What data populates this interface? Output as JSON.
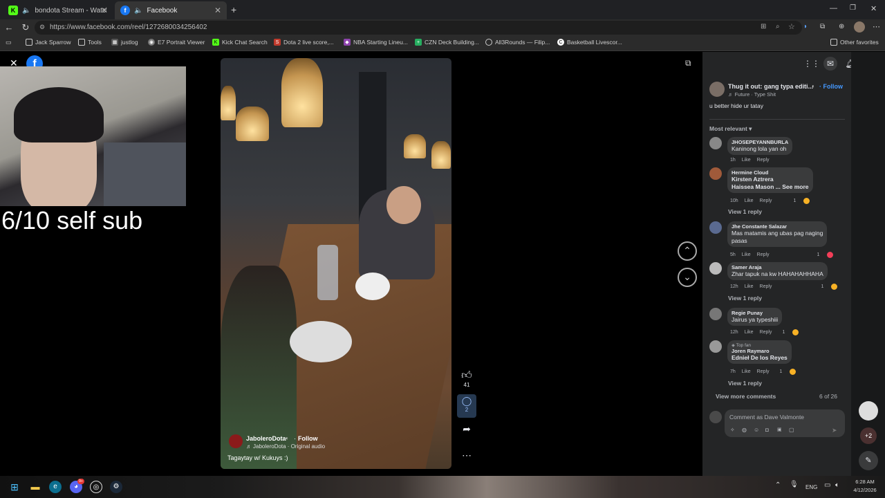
{
  "tabs": [
    {
      "title": "bondota Stream - Watch Live",
      "icon": "kick-icon",
      "active": false
    },
    {
      "title": "Facebook",
      "icon": "facebook-icon",
      "active": true
    }
  ],
  "address": {
    "url": "https://www.facebook.com/reel/1272680034256402"
  },
  "bookmarks": [
    {
      "label": "Jack Sparrow",
      "icon": "folder-icon"
    },
    {
      "label": "Tools",
      "icon": "folder-icon"
    },
    {
      "label": "justlog",
      "icon": "page-icon"
    },
    {
      "label": "E7 Portrait Viewer",
      "icon": "page-icon"
    },
    {
      "label": "Kick Chat Search",
      "icon": "kick-icon"
    },
    {
      "label": "Dota 2 live score,...",
      "icon": "page-icon"
    },
    {
      "label": "NBA Starting Lineu...",
      "icon": "page-icon"
    },
    {
      "label": "CZN Deck Building...",
      "icon": "page-icon"
    },
    {
      "label": "All3Rounds — Filip...",
      "icon": "globe-icon"
    },
    {
      "label": "Basketball Livescor...",
      "icon": "page-icon"
    },
    {
      "label": "Other favorites",
      "icon": "folder-icon"
    }
  ],
  "stream": {
    "overlay_text": "6/10 self sub"
  },
  "reel": {
    "author": "JaboleroDota",
    "follow_label": "Follow",
    "audio": "JaboleroDota · Original audio",
    "caption": "Tagaytay w/ Kukuys :)",
    "likes": "41",
    "comments": "2"
  },
  "panel": {
    "post_title": "Thug it out: gang typa editi...",
    "post_follow": "Follow",
    "post_audio": "Future · Type Shit",
    "post_caption": "u better hide ur tatay",
    "sort_label": "Most relevant",
    "comments": [
      {
        "name": "JHOSEPEYANNBURLA",
        "text": "Kaninong lola yan oh",
        "time": "1h",
        "like": "Like",
        "reply": "Reply",
        "reactions": ""
      },
      {
        "name": "Hermine Cloud",
        "text": "Kirsten Aztrera",
        "text2": "Haissea Mason ... See more",
        "time": "10h",
        "like": "Like",
        "reply": "Reply",
        "reactions": "1"
      },
      {
        "name": "Jhe Constante Salazar",
        "text": "Mas matamis ang ubas pag naging",
        "text2": "pasas",
        "time": "5h",
        "like": "Like",
        "reply": "Reply",
        "reactions": "1"
      },
      {
        "name": "Samer Araja",
        "text": "Zhar tapuk na kw HAHAHAHHAHA",
        "time": "12h",
        "like": "Like",
        "reply": "Reply",
        "reactions": "1"
      },
      {
        "name": "Regie Punay",
        "text": "Jairus ya typeshiii",
        "time": "12h",
        "like": "Like",
        "reply": "Reply",
        "reactions": "1"
      },
      {
        "name": "Joren Raymaro",
        "badge": "Top fan",
        "text": "Ednieł De los Reyes",
        "time": "7h",
        "like": "Like",
        "reply": "Reply",
        "reactions": "1"
      }
    ],
    "view_reply": "View 1 reply",
    "view_more": "View more comments",
    "count": "6 of 26",
    "comment_placeholder": "Comment as Dave Valmonte"
  },
  "rail": {
    "more_count": "+2"
  },
  "taskbar": {
    "lang": "ENG",
    "time": "6:28 AM",
    "date": "4/12/2026",
    "discord_badge": "9+"
  },
  "colors": {
    "facebook_blue": "#1877f2",
    "kick_green": "#53fc18",
    "panel_bg": "#242526"
  }
}
